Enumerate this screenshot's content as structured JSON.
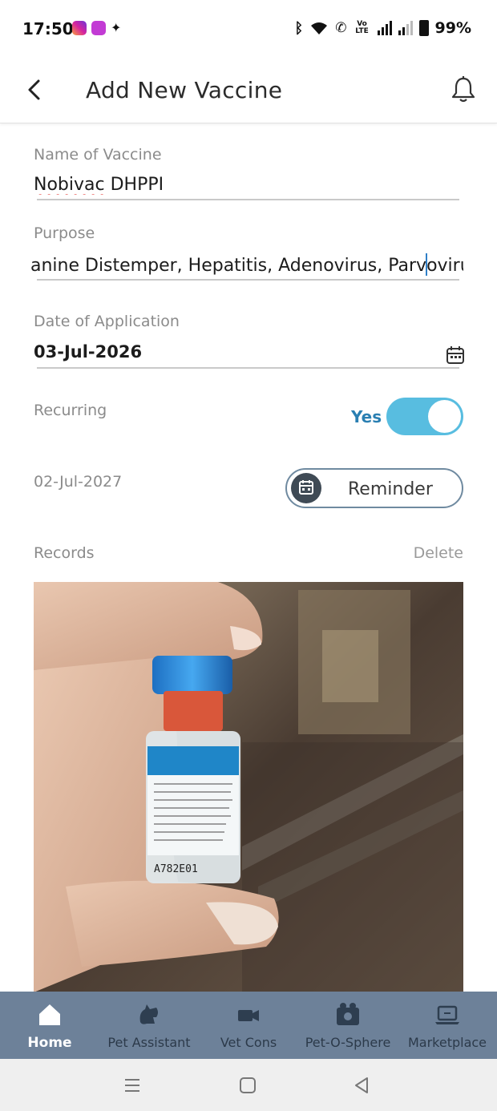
{
  "status": {
    "time": "17:50",
    "battery": "99%",
    "volte": "Vo LTE"
  },
  "header": {
    "title": "Add New Vaccine"
  },
  "form": {
    "name_label": "Name of Vaccine",
    "name_value_part1": "Nobivac",
    "name_value_part2": " DHPPI",
    "purpose_label": "Purpose",
    "purpose_value_before_caret": "anine Distemper, Hepatitis, Adenovirus, Parv",
    "purpose_value_after_caret": "oviru",
    "date_label": "Date of Application",
    "date_value": "03-Jul-2026",
    "recurring_label": "Recurring",
    "recurring_value": "Yes",
    "recurring_on": true,
    "next_date": "02-Jul-2027",
    "reminder_label": "Reminder",
    "records_label": "Records",
    "delete_label": "Delete"
  },
  "photo": {
    "vial_lot_text": "A782E01"
  },
  "bottom_nav": {
    "items": [
      {
        "label": "Home",
        "icon": "home-icon",
        "active": true
      },
      {
        "label": "Pet Assistant",
        "icon": "pet-assistant-icon",
        "active": false
      },
      {
        "label": "Vet Cons",
        "icon": "video-camera-icon",
        "active": false
      },
      {
        "label": "Pet-O-Sphere",
        "icon": "pet-o-sphere-icon",
        "active": false
      },
      {
        "label": "Marketplace",
        "icon": "laptop-icon",
        "active": false
      }
    ]
  },
  "colors": {
    "accent": "#58bde0",
    "yes_text": "#2a7fb2",
    "nav_bg": "#6d8199",
    "label_gray": "#8b8b8b"
  }
}
